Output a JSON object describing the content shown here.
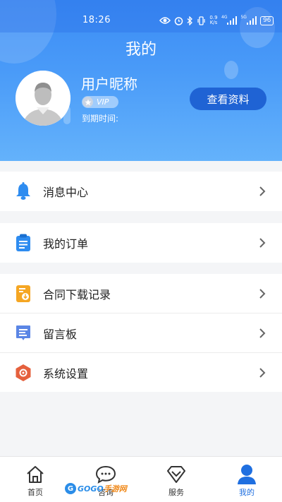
{
  "status_bar": {
    "time": "18:26",
    "net_speed_value": "0.9",
    "net_speed_unit": "K/s",
    "signal1": "4G",
    "signal2": "5G",
    "battery": "96"
  },
  "header": {
    "title": "我的",
    "username": "用户昵称",
    "vip_badge": "VIP",
    "expire_label": "到期时间:",
    "view_profile_button": "查看资料"
  },
  "menu": [
    {
      "label": "消息中心",
      "icon": "bell-icon",
      "color": "#2e8cf0"
    },
    {
      "label": "我的订单",
      "icon": "clipboard-icon",
      "color": "#2e8cf0"
    },
    {
      "label": "合同下载记录",
      "icon": "document-download-icon",
      "color": "#f5a623"
    },
    {
      "label": "留言板",
      "icon": "message-board-icon",
      "color": "#5b86e5"
    },
    {
      "label": "系统设置",
      "icon": "settings-hexagon-icon",
      "color": "#e5603d"
    }
  ],
  "tabbar": {
    "tabs": [
      {
        "label": "首页",
        "icon": "home-icon",
        "active": false
      },
      {
        "label": "咨询",
        "icon": "chat-icon",
        "active": false
      },
      {
        "label": "服务",
        "icon": "diamond-icon",
        "active": false
      },
      {
        "label": "我的",
        "icon": "user-icon",
        "active": true
      }
    ]
  },
  "watermark": {
    "prefix": "GOGO",
    "suffix": "手游网"
  },
  "colors": {
    "accent": "#1f63d4",
    "header_gradient_top": "#3b8cf5",
    "header_gradient_bottom": "#64b2fb",
    "active_tab": "#1f6fe0"
  }
}
